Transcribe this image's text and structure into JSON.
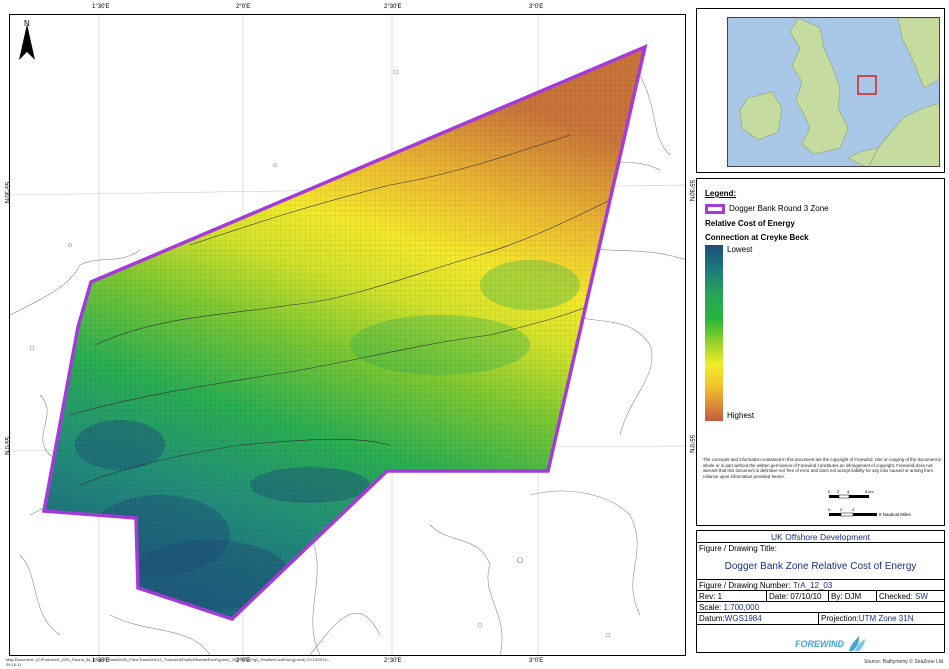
{
  "map": {
    "north_label": "N",
    "ticks_top": [
      "1°30'E",
      "2°0'E",
      "2°30'E",
      "3°0'E"
    ],
    "ticks_bottom": [
      "1°30'E",
      "2°0'E",
      "2°30'E",
      "3°0'E"
    ],
    "ticks_left": [
      "55°30'N",
      "55°0'N"
    ],
    "ticks_right": [
      "55°30'N",
      "55°0'N"
    ]
  },
  "colors": {
    "zone_outline": "#a43bd8",
    "lowest": "#1d4e78",
    "mid": "#26b53a",
    "high_yellow": "#f2ee28",
    "highest": "#c25a3e",
    "title_blue": "#1c2f8c"
  },
  "legend": {
    "title": "Legend:",
    "zone_label": "Dogger Bank Round 3 Zone",
    "rce_label": "Relative Cost of Energy",
    "connection_label": "Connection at Creyke Beck",
    "lowest": "Lowest",
    "highest": "Highest",
    "disclaimer": "The concepts and information contained in this document are the copyright of Forewind. Use or copying of the document in whole or in part without the written permission of Forewind constitutes an infringement of copyright. Forewind does not warrant that this document is definitive nor free of error and does not accept liability for any loss caused or arising from reliance upon information provided herein.",
    "scale_km_ticks": [
      "0",
      "2",
      "4",
      "8 km"
    ],
    "scale_nm_ticks": [
      "0",
      "2",
      "4"
    ],
    "scale_nm_label": "8 Nautical Miles"
  },
  "title_block": {
    "header": "UK Offshore Development",
    "figure_label": "Figure / Drawing Title:",
    "figure_title": "Dogger Bank Zone Relative Cost of Energy",
    "number_label": "Figure / Drawing Number:",
    "number_value": "TrA_12_03",
    "rev": "Rev: 1",
    "date": "Date: 07/10/10",
    "by": "By: DJM",
    "checked_label": "Checked:",
    "checked_value": "SW",
    "scale_label": "Scale:",
    "scale_value": "1:700,000",
    "datum_label": "Datum:",
    "datum_value": "WGS1984",
    "projection_label": "Projection:",
    "projection_value": "UTM Zone 31N",
    "logo": "FOREWIND"
  },
  "footer": {
    "left": "Map Document: (G:\\Forewind\\_GIS\\_Round_3#_Dogger_Bank\\MXD_Files\\TrancheA\\12_TrancheA\\PublicReleaseDocFigures\\_20101004\\Fig2_RelativeCostEnergy.mxd)  07/10/2010 -- 09:18:11",
    "right": "Source: Bathymetry © SeaZone Ltd"
  }
}
